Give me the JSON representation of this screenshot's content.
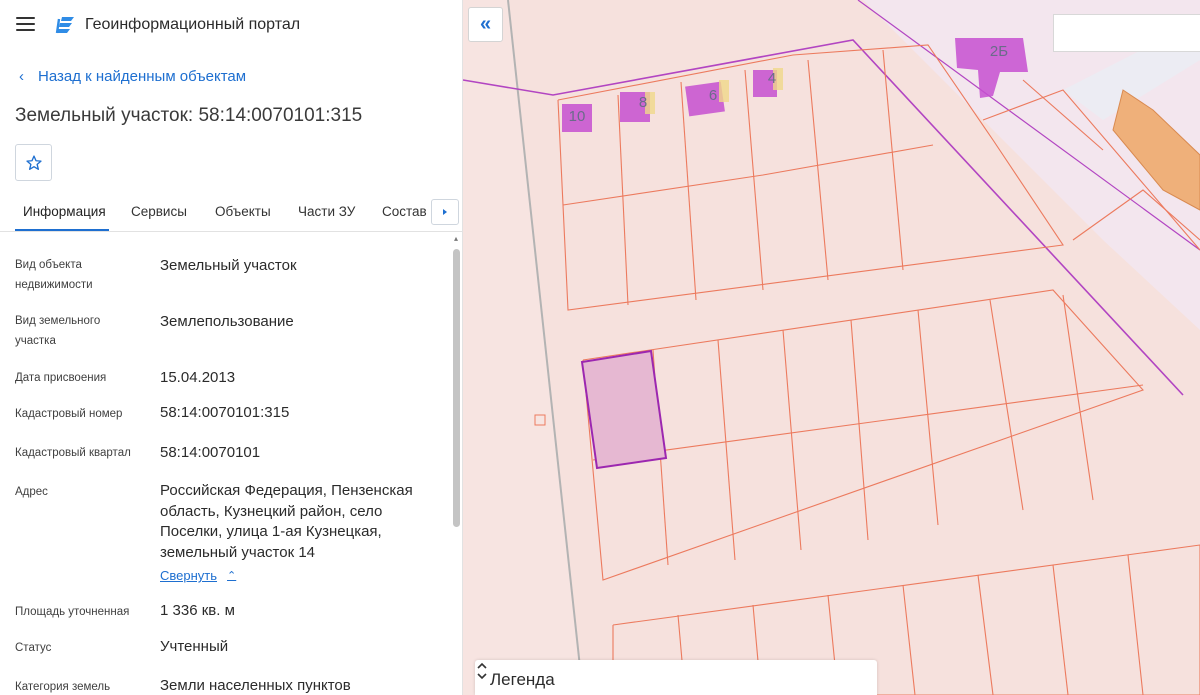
{
  "app": {
    "title": "Геоинформационный портал"
  },
  "nav": {
    "back_label": "Назад к найденным объектам"
  },
  "object": {
    "title": "Земельный участок: 58:14:0070101:315"
  },
  "tabs": [
    {
      "label": "Информация"
    },
    {
      "label": "Сервисы"
    },
    {
      "label": "Объекты"
    },
    {
      "label": "Части ЗУ"
    },
    {
      "label": "Состав"
    }
  ],
  "properties": [
    {
      "label": "Вид объекта недвижимости",
      "value": "Земельный участок"
    },
    {
      "label": "Вид земельного участка",
      "value": "Землепользование"
    },
    {
      "label": "Дата присвоения",
      "value": "15.04.2013"
    },
    {
      "label": "Кадастровый номер",
      "value": "58:14:0070101:315"
    },
    {
      "label": "Кадастровый квартал",
      "value": "58:14:0070101"
    },
    {
      "label": "Адрес",
      "value": "Российская Федерация, Пензенская область, Кузнецкий район, село Поселки, улица 1-ая Кузнецкая, земельный участок 14"
    },
    {
      "label": "Площадь уточненная",
      "value": "1 336 кв. м"
    },
    {
      "label": "Статус",
      "value": "Учтенный"
    },
    {
      "label": "Категория земель",
      "value": "Земли населенных пунктов"
    }
  ],
  "address_toggle": {
    "label": "Свернуть"
  },
  "map": {
    "legend_label": "Легенда",
    "building_labels": [
      "10",
      "8",
      "6",
      "4",
      "2Б"
    ]
  },
  "colors": {
    "accent": "#1e6fd0",
    "map_background": "#f6e1dd",
    "parcel_border": "#ec7a5e",
    "selected_fill": "#e6b8d2",
    "selected_border": "#9c27b0",
    "building_fill": "#c54fd0"
  },
  "icons": {
    "menu": "hamburger-icon",
    "logo": "portal-logo-icon",
    "back": "chevron-left-icon",
    "favorite": "star-outline-icon",
    "tabs_next": "triangle-right-icon",
    "collapse_panel": "double-chevron-left-icon",
    "address_collapse": "chevron-up-icon",
    "legend_toggle": "chevron-up-down-icon"
  }
}
